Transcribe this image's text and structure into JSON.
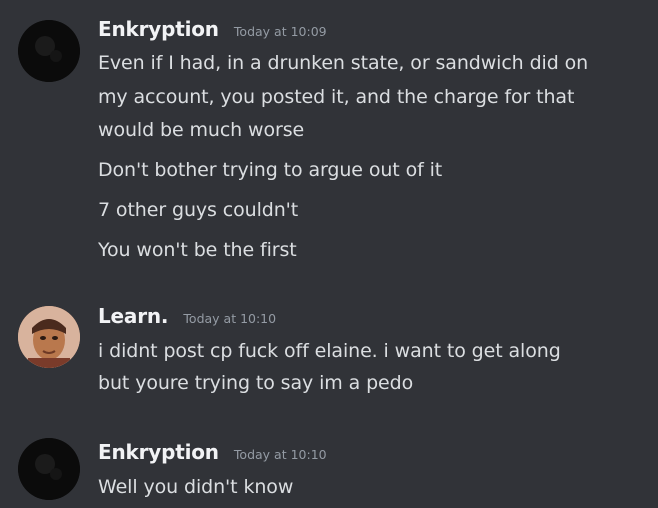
{
  "messages": [
    {
      "author": "Enkryption",
      "timestamp": "Today at 10:09",
      "avatar": "dark-avatar",
      "lines": [
        "Even if I had, in a drunken state, or sandwich did on",
        "my account, you posted it, and the charge for that",
        "would be much worse",
        "Don't bother trying to argue out of it",
        "7 other guys couldn't",
        "You won't be the first"
      ]
    },
    {
      "author": "Learn.",
      "timestamp": "Today at 10:10",
      "avatar": "face-photo-avatar",
      "lines": [
        "i didnt post cp fuck off elaine. i want to get along",
        "but youre trying to say im a pedo"
      ]
    },
    {
      "author": "Enkryption",
      "timestamp": "Today at 10:10",
      "avatar": "dark-avatar",
      "lines": [
        "Well you didn't know"
      ]
    }
  ]
}
